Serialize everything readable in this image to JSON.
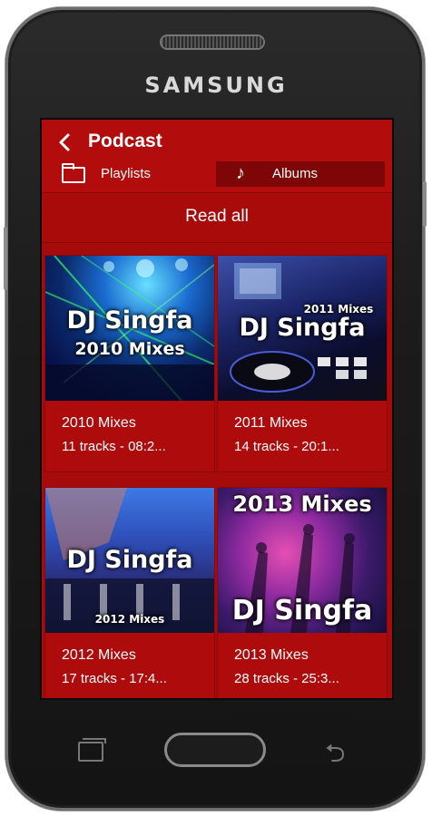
{
  "device": {
    "brand": "SAMSUNG"
  },
  "header": {
    "title": "Podcast",
    "back_icon": "chevron-left-icon"
  },
  "tabs": [
    {
      "label": "Playlists",
      "icon": "folder-icon",
      "active": false
    },
    {
      "label": "Albums",
      "icon": "music-note-icon",
      "active": true
    }
  ],
  "actions": {
    "read_all": "Read all"
  },
  "albums": [
    {
      "art_title": "DJ Singfa",
      "art_subtitle": "2010 Mixes",
      "title": "2010 Mixes",
      "subtitle": "11 tracks - 08:2..."
    },
    {
      "art_title": "DJ Singfa",
      "art_subtitle": "2011 Mixes",
      "title": "2011 Mixes",
      "subtitle": "14 tracks - 20:1..."
    },
    {
      "art_title": "DJ Singfa",
      "art_subtitle": "2012 Mixes",
      "title": "2012 Mixes",
      "subtitle": "17 tracks - 17:4..."
    },
    {
      "art_title": "DJ Singfa",
      "art_subtitle": "2013 Mixes",
      "title": "2013 Mixes",
      "subtitle": "28 tracks - 25:3..."
    }
  ],
  "colors": {
    "accent": "#b30c0c",
    "tab_active": "#7f0606"
  }
}
